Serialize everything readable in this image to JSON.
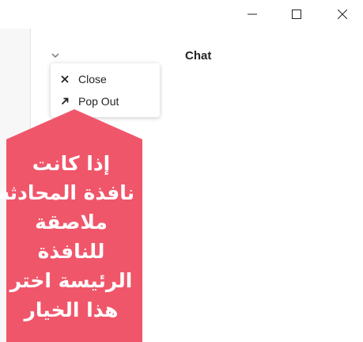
{
  "window": {
    "controls": [
      "minimize-icon",
      "maximize-icon",
      "close-icon"
    ]
  },
  "panel": {
    "title": "Chat",
    "collapse_icon": "chevron-down-icon"
  },
  "menu": {
    "items": [
      {
        "label": "Close",
        "icon": "close-x-icon"
      },
      {
        "label": "Pop Out",
        "icon": "arrow-up-right-icon"
      }
    ]
  },
  "callout": {
    "color": "#f0566a",
    "lines": [
      "إذا كانت",
      "نافذة المحادثة",
      "ملاصقة",
      "للنافذة",
      "الرئيسة اختر",
      "هذا الخيار"
    ]
  }
}
